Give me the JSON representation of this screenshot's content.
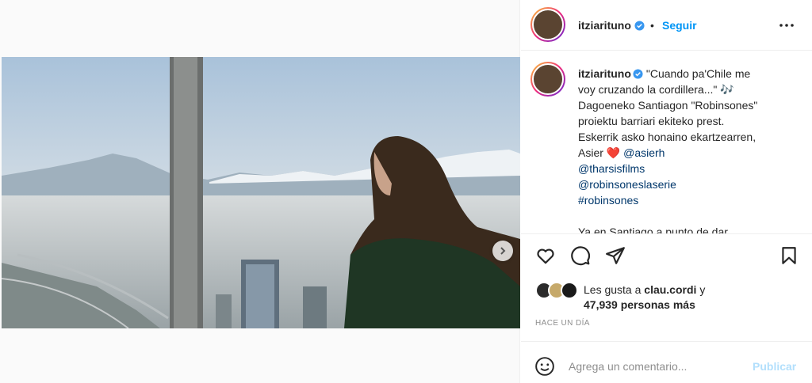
{
  "post": {
    "username": "itziarituno",
    "follow_label": "Seguir",
    "separator": "•",
    "caption_lines": [
      "\"Cuando pa'Chile me",
      "voy cruzando la cordillera...\" 🎶",
      "Dagoeneko Santiagon \"Robinsones\"",
      "proiektu barriari ekiteko prest.",
      "Eskerrik asko honaino ekartzearren,"
    ],
    "caption_asier": "Asier",
    "heart": "❤️",
    "mentions": [
      "@asierh",
      "@tharsisfilms",
      "@robinsoneslaserie"
    ],
    "hashtag": "#robinsones",
    "caption_more": "Ya en Santiago a punto de dar",
    "likes_prefix": "Les gusta a",
    "likes_user": "clau.cordi",
    "likes_suffix": "y",
    "likes_count": "47,939 personas más",
    "time": "HACE UN DÍA",
    "comment_placeholder": "Agrega un comentario...",
    "publish_label": "Publicar",
    "carousel": {
      "slides": 3,
      "current": 1
    }
  },
  "icons": {
    "verified": "verified-badge-icon",
    "more": "more-options-icon",
    "like": "heart-icon",
    "comment": "comment-icon",
    "share": "share-icon",
    "save": "bookmark-icon",
    "emoji": "emoji-icon",
    "next": "chevron-right-icon"
  },
  "colors": {
    "accent": "#0095f6",
    "link": "#00376b",
    "heart": "#ed4956",
    "muted": "#8e8e8e",
    "publish_disabled": "#b2dffc"
  }
}
